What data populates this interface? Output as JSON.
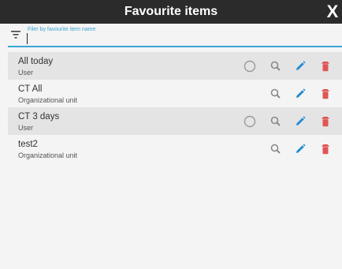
{
  "dialog": {
    "title": "Favourite items",
    "close_glyph": "X"
  },
  "filter": {
    "label": "Filer by favourite item name",
    "value": "",
    "icon": "filter-icon",
    "accent": "#3aa6d6"
  },
  "items": [
    {
      "name": "All today",
      "type": "User",
      "has_circle": true
    },
    {
      "name": "CT All",
      "type": "Organizational unit",
      "has_circle": false
    },
    {
      "name": "CT 3 days",
      "type": "User",
      "has_circle": true
    },
    {
      "name": "test2",
      "type": "Organizational unit",
      "has_circle": false
    }
  ],
  "colors": {
    "edit": "#1f8ad2",
    "delete": "#e05555",
    "search": "#8a8a8a",
    "header": "#2b2b2b"
  }
}
